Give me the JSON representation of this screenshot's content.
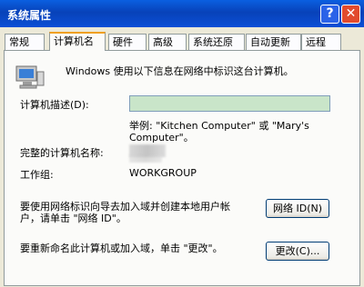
{
  "window": {
    "title": "系统属性",
    "help_glyph": "?",
    "close_glyph": "✕"
  },
  "tabs": [
    "常规",
    "计算机名",
    "硬件",
    "高级",
    "系统还原",
    "自动更新",
    "远程"
  ],
  "active_tab": "计算机名",
  "panel": {
    "intro": "Windows 使用以下信息在网络中标识这台计算机。",
    "description_label": "计算机描述(D):",
    "description_value": "",
    "example_line1": "举例: \"Kitchen Computer\" 或 \"Mary's",
    "example_line2": "Computer\"。",
    "fullname_label": "完整的计算机名称:",
    "workgroup_label": "工作组:",
    "workgroup_value": "WORKGROUP",
    "network_text_line1": "要使用网络标识向导去加入域并创建本地用户帐",
    "network_text_line2": "户，请单击 \"网络 ID\"。",
    "network_button": "网络 ID(N)",
    "rename_text": "要重新命名此计算机或加入域，单击 \"更改\"。",
    "change_button": "更改(C)..."
  }
}
